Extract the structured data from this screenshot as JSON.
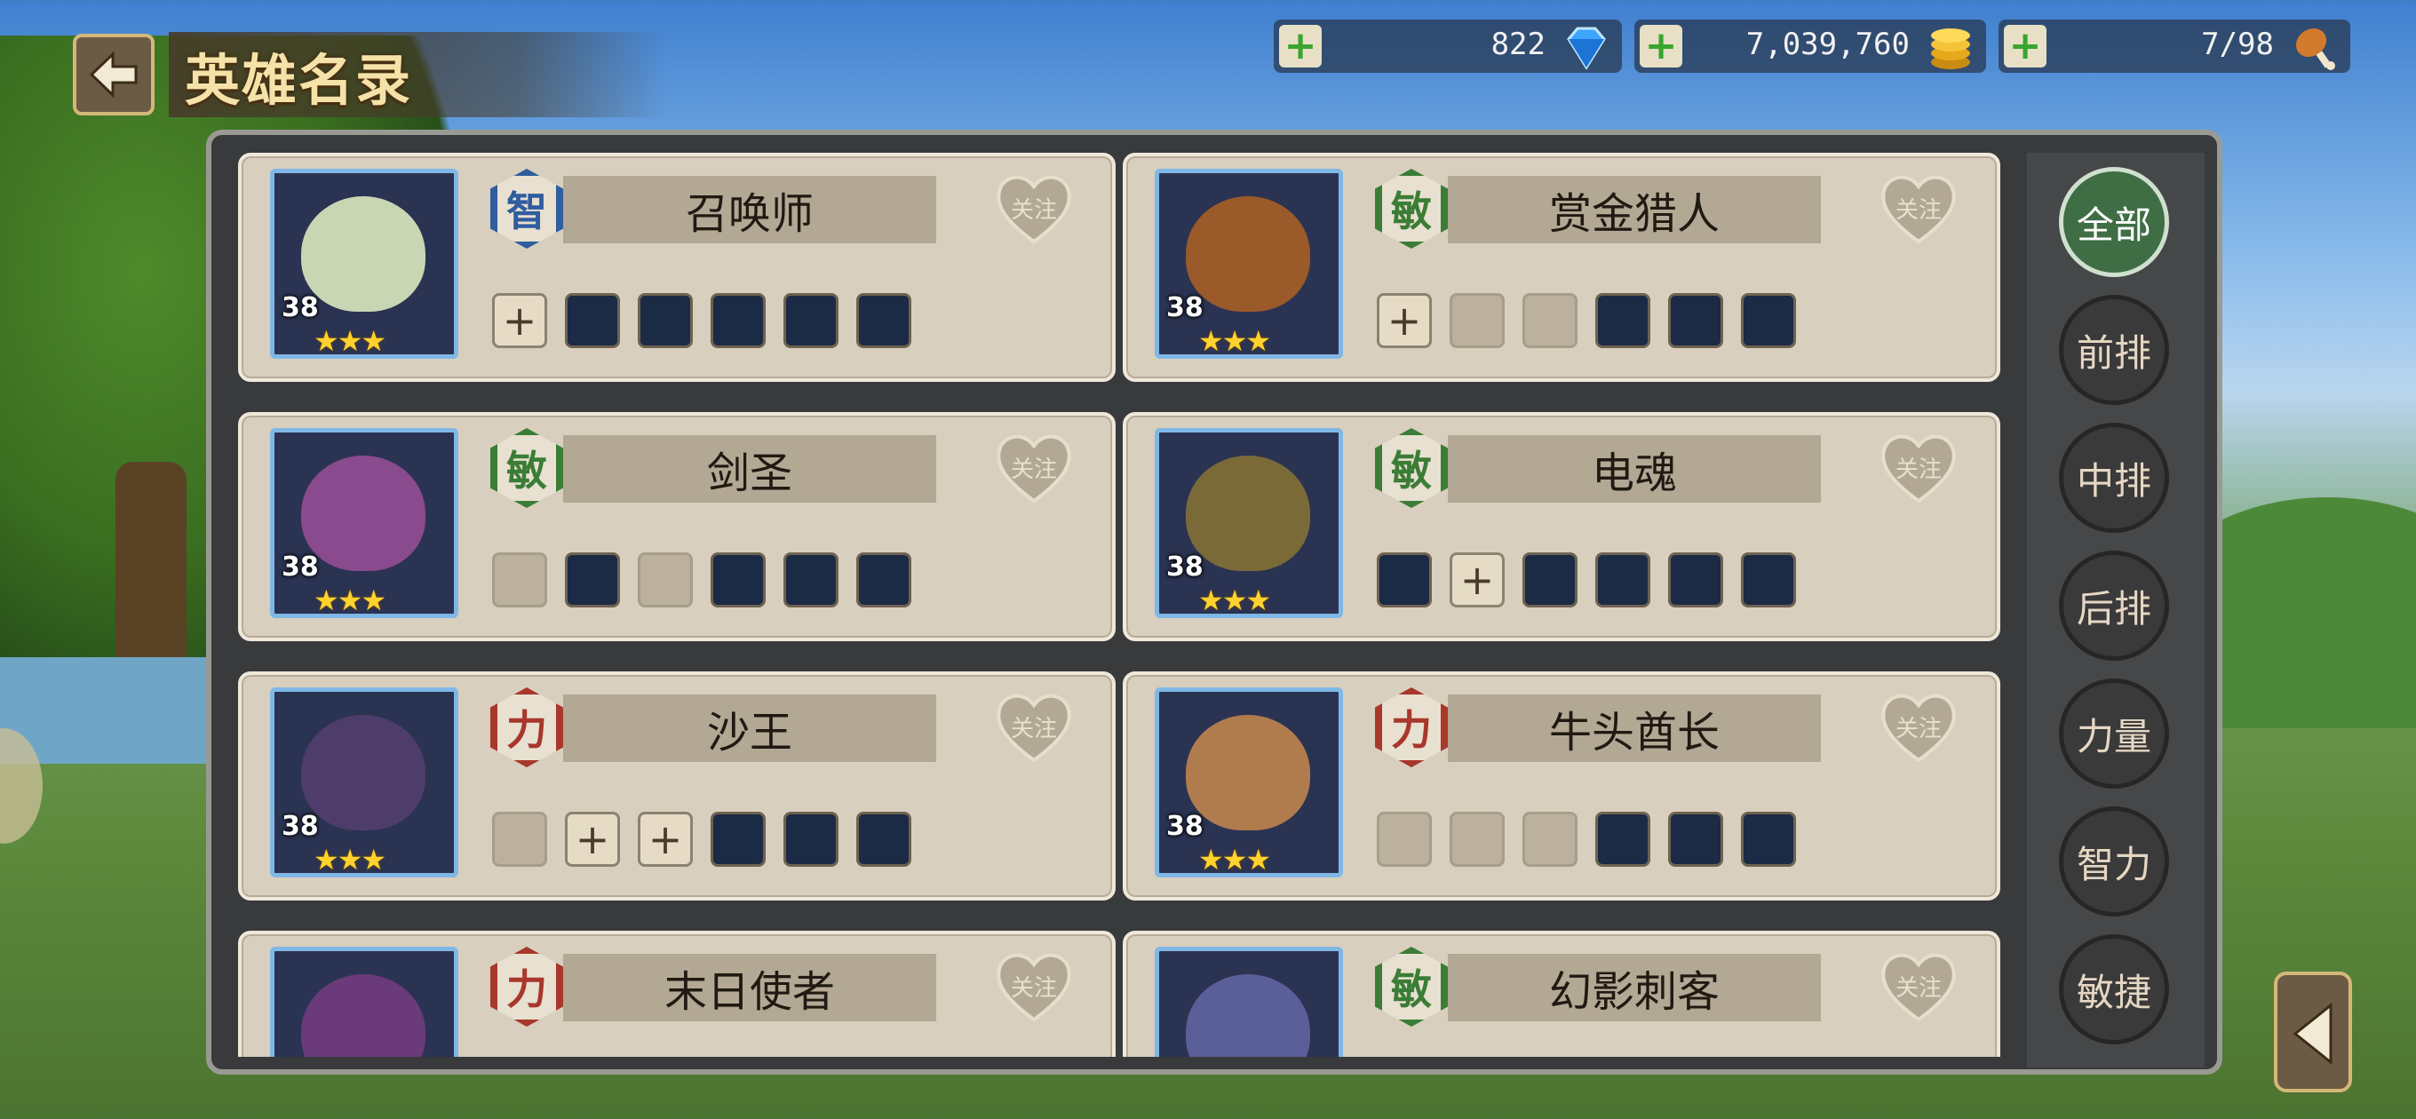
{
  "header": {
    "title": "英雄名录"
  },
  "resources": [
    {
      "name": "diamonds",
      "value": "822",
      "icon": "diamond-icon"
    },
    {
      "name": "gold",
      "value": "7,039,760",
      "icon": "gold-coins-icon"
    },
    {
      "name": "stamina",
      "value": "7/98",
      "icon": "drumstick-icon"
    }
  ],
  "heroes": [
    {
      "name": "召唤师",
      "attr": "智",
      "attr_color": "#2f5d9e",
      "level": "38",
      "stars": "★★★",
      "follow": "关注",
      "slots": [
        "plus",
        "item",
        "item",
        "item",
        "item",
        "item"
      ],
      "portrait_color": "#c9d6b4"
    },
    {
      "name": "赏金猎人",
      "attr": "敏",
      "attr_color": "#3b7d36",
      "level": "38",
      "stars": "★★★",
      "follow": "关注",
      "slots": [
        "plus",
        "empty",
        "empty",
        "item",
        "item",
        "item"
      ],
      "portrait_color": "#9b5a2a"
    },
    {
      "name": "剑圣",
      "attr": "敏",
      "attr_color": "#3b7d36",
      "level": "38",
      "stars": "★★★",
      "follow": "关注",
      "slots": [
        "empty",
        "item",
        "empty",
        "item",
        "item",
        "item"
      ],
      "portrait_color": "#8a4a8e"
    },
    {
      "name": "电魂",
      "attr": "敏",
      "attr_color": "#3b7d36",
      "level": "38",
      "stars": "★★★",
      "follow": "关注",
      "slots": [
        "item",
        "plus",
        "item",
        "item",
        "item",
        "item"
      ],
      "portrait_color": "#7a6a38"
    },
    {
      "name": "沙王",
      "attr": "力",
      "attr_color": "#a8372c",
      "level": "38",
      "stars": "★★★",
      "follow": "关注",
      "slots": [
        "empty",
        "plus",
        "plus",
        "item",
        "item",
        "item"
      ],
      "portrait_color": "#4e3d6a"
    },
    {
      "name": "牛头酋长",
      "attr": "力",
      "attr_color": "#a8372c",
      "level": "38",
      "stars": "★★★",
      "follow": "关注",
      "slots": [
        "empty",
        "empty",
        "empty",
        "item",
        "item",
        "item"
      ],
      "portrait_color": "#b07c4e"
    },
    {
      "name": "末日使者",
      "attr": "力",
      "attr_color": "#a8372c",
      "level": "",
      "stars": "",
      "follow": "关注",
      "slots": [],
      "portrait_color": "#6a3a7a"
    },
    {
      "name": "幻影刺客",
      "attr": "敏",
      "attr_color": "#3b7d36",
      "level": "",
      "stars": "",
      "follow": "关注",
      "slots": [],
      "portrait_color": "#5a5f9a"
    }
  ],
  "filters": [
    {
      "label": "全部",
      "active": true
    },
    {
      "label": "前排",
      "active": false
    },
    {
      "label": "中排",
      "active": false
    },
    {
      "label": "后排",
      "active": false
    },
    {
      "label": "力量",
      "active": false
    },
    {
      "label": "智力",
      "active": false
    },
    {
      "label": "敏捷",
      "active": false
    }
  ]
}
